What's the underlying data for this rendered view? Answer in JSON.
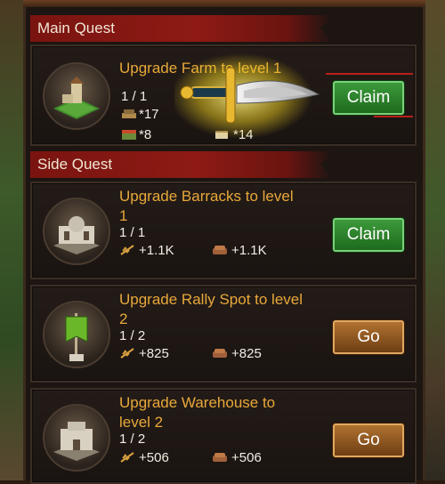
{
  "main_section": {
    "label": "Main Quest"
  },
  "side_section": {
    "label": "Side Quest"
  },
  "main_quest": {
    "title": "Upgrade Farm to level 1",
    "progress": "1 / 1",
    "rewards": [
      {
        "icon": "books-icon",
        "value": "*17"
      },
      {
        "icon": "scrolls-icon",
        "value": "*14"
      },
      {
        "icon": "chest-icon",
        "value": "*8"
      }
    ],
    "button": "Claim"
  },
  "side_quests": [
    {
      "title_line1": "Upgrade Barracks to level",
      "title_line2": "1",
      "progress": "1 / 1",
      "food": "+1.1K",
      "wood": "+1.1K",
      "button": "Claim"
    },
    {
      "title_line1": "Upgrade Rally Spot to level",
      "title_line2": "2",
      "progress": "1 / 2",
      "food": "+825",
      "wood": "+825",
      "button": "Go"
    },
    {
      "title_line1": "Upgrade Warehouse to",
      "title_line2": "level 2",
      "progress": "1 / 2",
      "food": "+506",
      "wood": "+506",
      "button": "Go"
    }
  ],
  "colors": {
    "title": "#e8a83a",
    "banner": "#8e1a14",
    "claim": "#2e8a2c",
    "go": "#9a5e24"
  }
}
